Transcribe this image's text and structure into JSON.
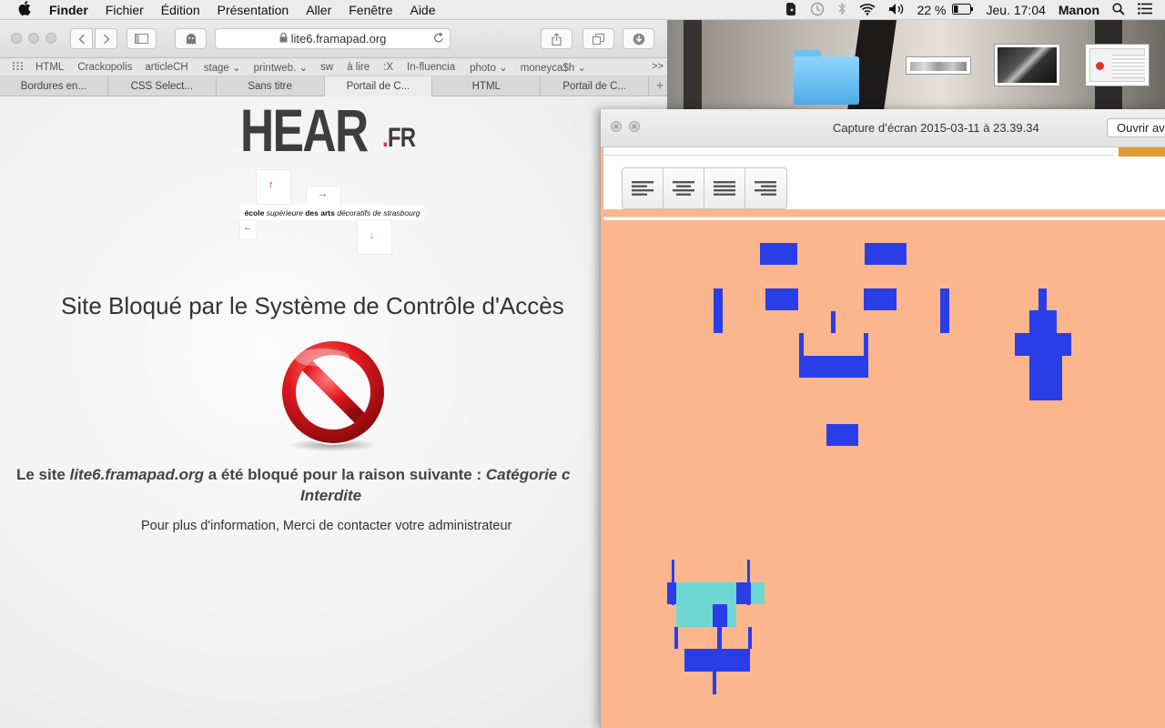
{
  "menubar": {
    "app": "Finder",
    "items": [
      "Fichier",
      "Édition",
      "Présentation",
      "Aller",
      "Fenêtre",
      "Aide"
    ],
    "battery": "22 %",
    "clock": "Jeu. 17:04",
    "user": "Manon"
  },
  "safari": {
    "url": "lite6.framapad.org",
    "bookmarks": [
      "HTML",
      "Crackopolis",
      "articleCH",
      "stage ⌄",
      "printweb. ⌄",
      "sw",
      "à lire",
      ":X",
      "In-fluencia",
      "photo ⌄",
      "moneyca$h ⌄"
    ],
    "tabs": [
      "Bordures en...",
      "CSS Select...",
      "Sans titre",
      "Portail de C...",
      "HTML",
      "Portail de C..."
    ],
    "active_tab": 3
  },
  "page": {
    "logo_main": "HEAR",
    "logo_dot": ".",
    "logo_fr": "FR",
    "tagline_bold": "école",
    "tagline_italic": "supérieure",
    "tagline_bold2": "des arts",
    "tagline_rest": "décoratifs de strasbourg",
    "title": "Site Bloqué par le Système de Contrôle d'Accès",
    "reason_prefix": "Le site",
    "reason_site": "lite6.framapad.org",
    "reason_mid": "a été bloqué pour la raison suivante :",
    "reason_cat": "Catégorie c",
    "reason_line2": "Interdite",
    "info": "Pour plus d'information, Merci de contacter votre administrateur"
  },
  "preview": {
    "title": "Capture d’écran 2015-03-11 à 23.39.34",
    "open_button": "Ouvrir av",
    "align_buttons": [
      "align-left",
      "align-center",
      "align-justify",
      "align-right"
    ]
  },
  "colors": {
    "canvas_bg": "#fbb68d",
    "block_blue": "#2a3ee8",
    "block_cyan": "#6fd8d2",
    "accent_orange": "#e39a34"
  }
}
